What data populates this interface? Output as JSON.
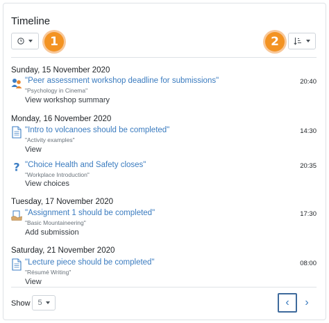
{
  "header": {
    "title": "Timeline"
  },
  "toolbar": {
    "filter_icon": "clock-icon",
    "sort_icon": "sort-icon"
  },
  "badges": {
    "one": "1",
    "two": "2",
    "color": "#f39322"
  },
  "days": [
    {
      "date": "Sunday, 15 November 2020",
      "events": [
        {
          "icon": "workshop-icon",
          "title": "\"Peer assessment workshop deadline for submissions\"",
          "course": "\"Psychology in Cinema\"",
          "action": "View workshop summary",
          "time": "20:40"
        }
      ]
    },
    {
      "date": "Monday, 16 November 2020",
      "events": [
        {
          "icon": "page-icon",
          "title": "\"Intro to volcanoes should be completed\"",
          "course": "\"Activity examples\"",
          "action": "View",
          "time": "14:30"
        },
        {
          "icon": "question-icon",
          "title": "\"Choice Health and Safety closes\"",
          "course": "\"Workplace Introduction\"",
          "action": "View choices",
          "time": "20:35"
        }
      ]
    },
    {
      "date": "Tuesday, 17 November 2020",
      "events": [
        {
          "icon": "assignment-icon",
          "title": "\"Assignment 1 should be completed\"",
          "course": "\"Basic Mountaineering\"",
          "action": "Add submission",
          "time": "17:30"
        }
      ]
    },
    {
      "date": "Saturday, 21 November 2020",
      "events": [
        {
          "icon": "page-icon",
          "title": "\"Lecture piece should be completed\"",
          "course": "\"Résumé Writing\"",
          "action": "View",
          "time": "08:00"
        }
      ]
    }
  ],
  "footer": {
    "show_label": "Show",
    "show_value": "5",
    "prev": "‹",
    "next": "›"
  },
  "colors": {
    "link": "#3a7bbf",
    "muted": "#6a737b",
    "border": "#dee2e6"
  }
}
